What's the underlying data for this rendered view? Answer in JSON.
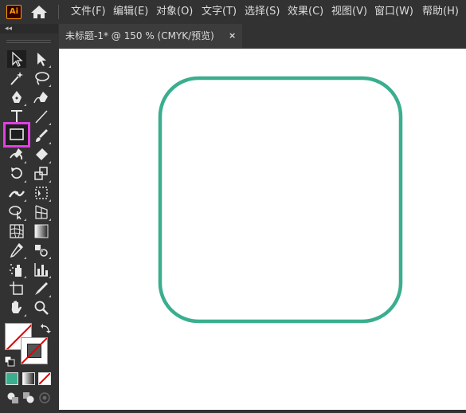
{
  "app": {
    "logo_text": "Ai",
    "brand_color": "#ff9a00",
    "home_icon": "home-icon"
  },
  "menu": [
    "文件(F)",
    "编辑(E)",
    "对象(O)",
    "文字(T)",
    "选择(S)",
    "效果(C)",
    "视图(V)",
    "窗口(W)",
    "帮助(H)"
  ],
  "panel": {
    "collapse_glyph": "◂◂"
  },
  "document_tab": {
    "title": "未标题-1* @ 150 % (CMYK/预览)",
    "close": "×"
  },
  "tools": [
    "selection-tool",
    "direct-selection-tool",
    "magic-wand-tool",
    "lasso-tool",
    "pen-tool",
    "curvature-tool",
    "type-tool",
    "line-segment-tool",
    "rectangle-tool",
    "paintbrush-tool",
    "shaper-tool",
    "eraser-tool",
    "rotate-tool",
    "scale-tool",
    "width-tool",
    "free-transform-tool",
    "shape-builder-tool",
    "perspective-grid-tool",
    "mesh-tool",
    "gradient-tool",
    "eyedropper-tool",
    "blend-tool",
    "symbol-sprayer-tool",
    "column-graph-tool",
    "artboard-tool",
    "slice-tool",
    "hand-tool",
    "zoom-tool"
  ],
  "selected_tool": "rectangle-tool",
  "colors": {
    "highlight": "#e040e0",
    "stroke": "#3aae8e",
    "fill_none_line": "#e00000",
    "canvas": "#ffffff"
  },
  "artwork": {
    "shape": "rounded-rectangle",
    "stroke_color": "#3aae8e",
    "fill": "none"
  }
}
